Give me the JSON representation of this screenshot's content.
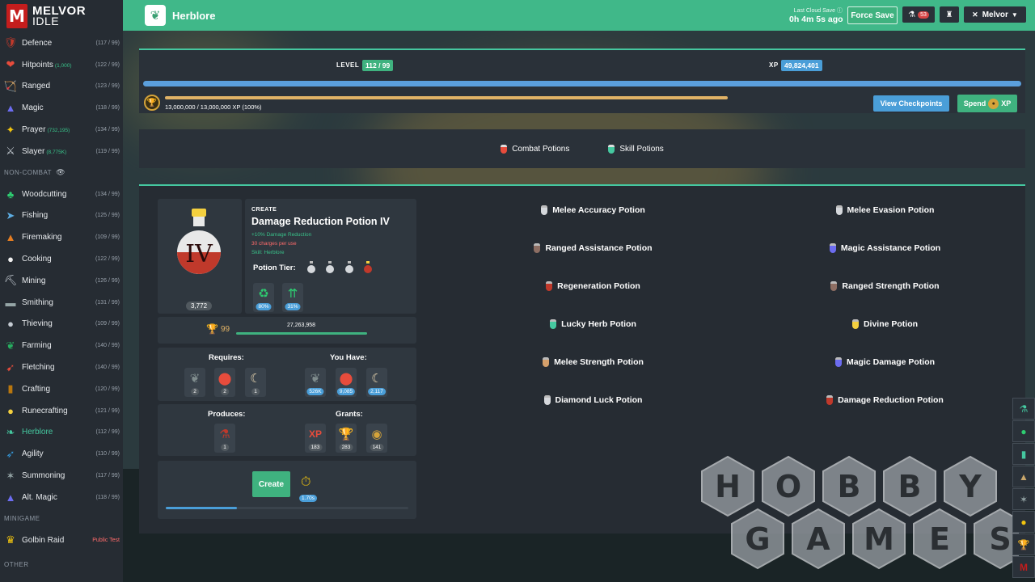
{
  "app": {
    "logo_line1": "MELVOR",
    "logo_line2": "IDLE",
    "logo_mark": "M"
  },
  "header": {
    "title": "Herblore",
    "last_save_label": "Last Cloud Save",
    "last_save_time": "0h 4m 5s ago",
    "force_save": "Force Save",
    "notif_count": "53",
    "user": "Melvor"
  },
  "sidebar": {
    "combat": [
      {
        "name": "Defence",
        "sub": "",
        "level": "(117 / 99)",
        "icon": "🛡",
        "color": "#c0392b"
      },
      {
        "name": "Hitpoints",
        "sub": "(1,000)",
        "level": "(122 / 99)",
        "icon": "❤",
        "color": "#e74c3c"
      },
      {
        "name": "Ranged",
        "sub": "",
        "level": "(123 / 99)",
        "icon": "🏹",
        "color": "#c9a66b"
      },
      {
        "name": "Magic",
        "sub": "",
        "level": "(118 / 99)",
        "icon": "▲",
        "color": "#6c6cf0"
      },
      {
        "name": "Prayer",
        "sub": "(732,195)",
        "level": "(134 / 99)",
        "icon": "✦",
        "color": "#f1c40f"
      },
      {
        "name": "Slayer",
        "sub": "(8,775K)",
        "level": "(119 / 99)",
        "icon": "⚔",
        "color": "#c5ccd3"
      }
    ],
    "noncombat_label": "NON-COMBAT",
    "noncombat": [
      {
        "name": "Woodcutting",
        "level": "(134 / 99)",
        "icon": "♣",
        "color": "#2ecc71"
      },
      {
        "name": "Fishing",
        "level": "(125 / 99)",
        "icon": "➤",
        "color": "#5dade2"
      },
      {
        "name": "Firemaking",
        "level": "(109 / 99)",
        "icon": "▲",
        "color": "#e67e22"
      },
      {
        "name": "Cooking",
        "level": "(122 / 99)",
        "icon": "●",
        "color": "#f0f0f0"
      },
      {
        "name": "Mining",
        "level": "(126 / 99)",
        "icon": "⛏",
        "color": "#c5ccd3"
      },
      {
        "name": "Smithing",
        "level": "(131 / 99)",
        "icon": "▬",
        "color": "#95a5a6"
      },
      {
        "name": "Thieving",
        "level": "(109 / 99)",
        "icon": "●",
        "color": "#c5ccd3"
      },
      {
        "name": "Farming",
        "level": "(140 / 99)",
        "icon": "❦",
        "color": "#27ae60"
      },
      {
        "name": "Fletching",
        "level": "(140 / 99)",
        "icon": "➹",
        "color": "#e74c3c"
      },
      {
        "name": "Crafting",
        "level": "(120 / 99)",
        "icon": "▮",
        "color": "#b9770e"
      },
      {
        "name": "Runecrafting",
        "level": "(121 / 99)",
        "icon": "●",
        "color": "#f4d03f"
      },
      {
        "name": "Herblore",
        "level": "(112 / 99)",
        "icon": "❧",
        "color": "#45c8a0"
      },
      {
        "name": "Agility",
        "level": "(110 / 99)",
        "icon": "➶",
        "color": "#3498db"
      },
      {
        "name": "Summoning",
        "level": "(117 / 99)",
        "icon": "✶",
        "color": "#95a5a6"
      },
      {
        "name": "Alt. Magic",
        "level": "(118 / 99)",
        "icon": "▲",
        "color": "#6c6cf0"
      }
    ],
    "minigame_label": "MINIGAME",
    "minigame": {
      "name": "Golbin Raid",
      "tag": "Public Test",
      "icon": "♛",
      "color": "#f1c40f"
    },
    "other_label": "OTHER"
  },
  "xp": {
    "level_label": "LEVEL",
    "level_value": "112 / 99",
    "xp_label": "XP",
    "xp_value": "49,824,401",
    "mastery_text": "13,000,000 / 13,000,000 XP (100%)",
    "view_checkpoints": "View Checkpoints",
    "spend_label": "Spend",
    "spend_suffix": "XP"
  },
  "categories": [
    {
      "label": "Combat Potions",
      "color": "#e74c3c"
    },
    {
      "label": "Skill Potions",
      "color": "#45c8a0"
    }
  ],
  "create": {
    "label": "CREATE",
    "name": "Damage Reduction Potion IV",
    "stat1": "+10% Damage Reduction",
    "stat2": "30 charges per use",
    "stat3": "Skill: Herblore",
    "owned": "3,772",
    "tier_label": "Potion Tier:",
    "tier_numeral": "IV",
    "bonus1": "80%",
    "bonus2": "31%",
    "mastery_level": "99",
    "mastery_xp": "27,263,958",
    "requires_label": "Requires:",
    "have_label": "You Have:",
    "requires": [
      "2",
      "2",
      "1"
    ],
    "have": [
      "526K",
      "9,085",
      "2,117"
    ],
    "produces_label": "Produces:",
    "grants_label": "Grants:",
    "produces": "1",
    "grants": [
      "183",
      "283",
      "141"
    ],
    "grants_xp_label": "XP",
    "button": "Create",
    "interval": "1.70s"
  },
  "recipes": {
    "left": [
      "Melee Accuracy Potion",
      "Ranged Assistance Potion",
      "Regeneration Potion",
      "Lucky Herb Potion",
      "Melee Strength Potion",
      "Diamond Luck Potion"
    ],
    "right": [
      "Melee Evasion Potion",
      "Magic Assistance Potion",
      "Ranged Strength Potion",
      "Divine Potion",
      "Magic Damage Potion",
      "Damage Reduction Potion"
    ]
  },
  "watermark": {
    "line1": "HOBBY",
    "line2": "GAMES"
  }
}
